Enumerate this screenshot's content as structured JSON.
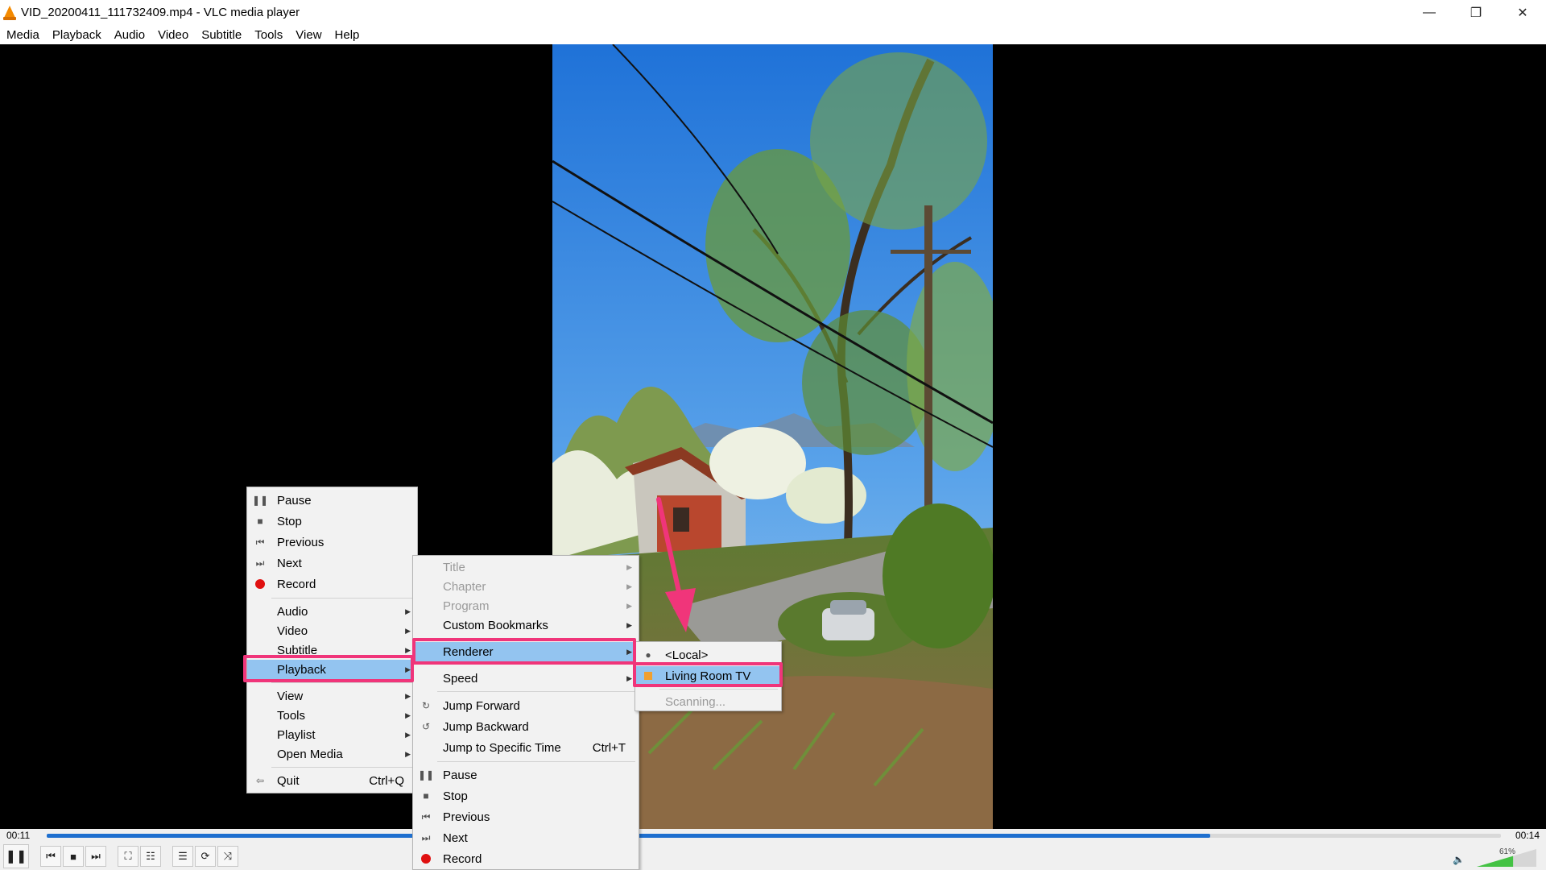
{
  "window": {
    "title": "VID_20200411_111732409.mp4 - VLC media player",
    "minimize": "—",
    "maximize": "❐",
    "close": "✕"
  },
  "menubar": [
    "Media",
    "Playback",
    "Audio",
    "Video",
    "Subtitle",
    "Tools",
    "View",
    "Help"
  ],
  "player": {
    "elapsed": "00:11",
    "total": "00:14",
    "progress": 0.8,
    "volume_label": "61%",
    "volume": 0.61
  },
  "main_menu": {
    "items": [
      {
        "label": "Pause",
        "icon": "pause-icon"
      },
      {
        "label": "Stop",
        "icon": "stop-icon"
      },
      {
        "label": "Previous",
        "icon": "previous-icon"
      },
      {
        "label": "Next",
        "icon": "next-icon"
      },
      {
        "label": "Record",
        "icon": "record-icon"
      },
      {
        "label": "Audio"
      },
      {
        "label": "Video"
      },
      {
        "label": "Subtitle"
      },
      {
        "label": "Playback"
      },
      {
        "label": "View"
      },
      {
        "label": "Tools"
      },
      {
        "label": "Playlist"
      },
      {
        "label": "Open Media"
      },
      {
        "label": "Quit",
        "shortcut": "Ctrl+Q",
        "icon": "quit-icon"
      }
    ]
  },
  "playback_menu": {
    "items": [
      {
        "label": "Title"
      },
      {
        "label": "Chapter"
      },
      {
        "label": "Program"
      },
      {
        "label": "Custom Bookmarks"
      },
      {
        "label": "Renderer"
      },
      {
        "label": "Speed"
      },
      {
        "label": "Jump Forward",
        "icon": "jump-forward-icon"
      },
      {
        "label": "Jump Backward",
        "icon": "jump-backward-icon"
      },
      {
        "label": "Jump to Specific Time",
        "shortcut": "Ctrl+T"
      },
      {
        "label": "Pause",
        "icon": "pause-icon"
      },
      {
        "label": "Stop",
        "icon": "stop-icon"
      },
      {
        "label": "Previous",
        "icon": "previous-icon"
      },
      {
        "label": "Next",
        "icon": "next-icon"
      },
      {
        "label": "Record",
        "icon": "record-icon"
      }
    ]
  },
  "renderer_menu": {
    "items": [
      {
        "label": "<Local>"
      },
      {
        "label": "Living Room TV"
      },
      {
        "label": "Scanning..."
      }
    ]
  },
  "colors": {
    "highlight": "#93c4f0",
    "annotation": "#f0357a",
    "seek": "#1e6fcf"
  }
}
